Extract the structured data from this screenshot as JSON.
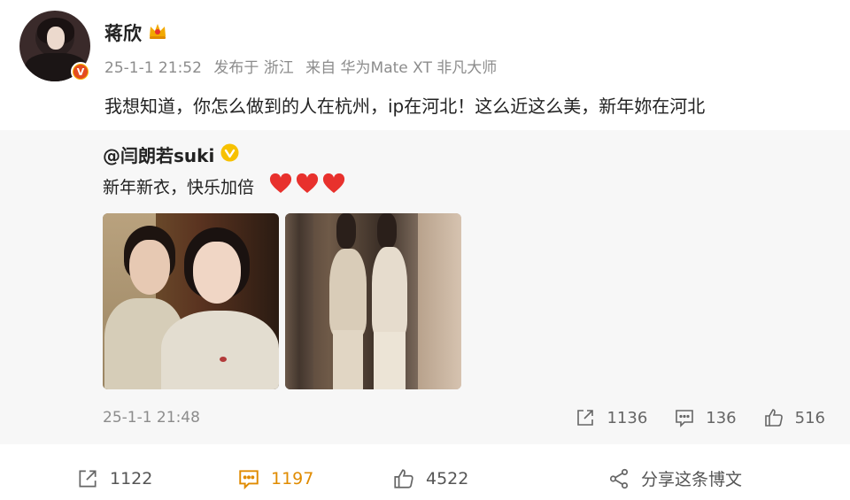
{
  "post": {
    "author": "蒋欣",
    "meta": {
      "time": "25-1-1 21:52",
      "location": "发布于 浙江",
      "source": "来自 华为Mate XT 非凡大师"
    },
    "text": "我想知道，你怎么做到的人在杭州，ip在河北！这么近这么美，新年妳在河北",
    "verified_badge": "V"
  },
  "repost": {
    "author": "@闫朗若suki",
    "text": "新年新衣，快乐加倍",
    "hearts": [
      "heart-icon",
      "heart-icon",
      "heart-icon"
    ],
    "time": "25-1-1 21:48",
    "actions": {
      "forward": "1136",
      "comment": "136",
      "like": "516"
    }
  },
  "toolbar": {
    "forward": "1122",
    "comment": "1197",
    "like": "4522",
    "share": "分享这条博文"
  },
  "colors": {
    "accent_comment": "#e08b00",
    "meta_gray": "#8c8c8c",
    "repost_bg": "#f7f7f7",
    "heart_red": "#e8312d",
    "badge_gold": "#f7b500"
  }
}
